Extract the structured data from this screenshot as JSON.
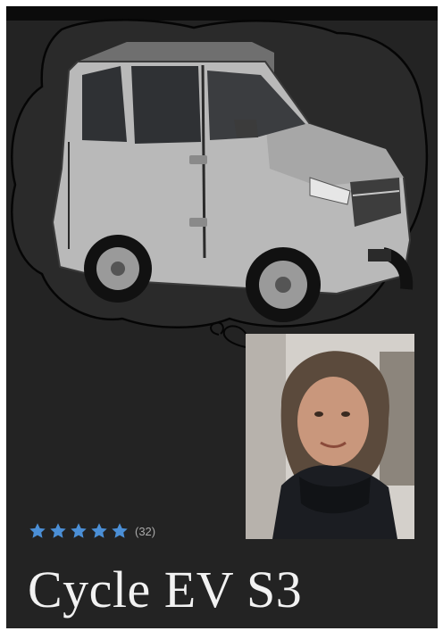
{
  "product": {
    "rating": {
      "stars": 5,
      "count_label": "(32)"
    },
    "title": "Cycle EV S3"
  },
  "icons": {
    "star": "star-icon"
  },
  "colors": {
    "background": "#232323",
    "star": "#4b8fd6",
    "title": "#f2f2f2"
  }
}
